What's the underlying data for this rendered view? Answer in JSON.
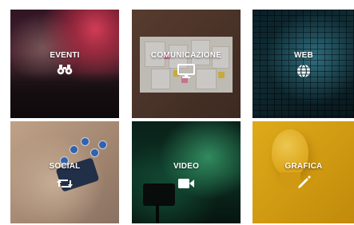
{
  "tiles": [
    {
      "label": "EVENTI",
      "icon": "binoculars-icon"
    },
    {
      "label": "COMUNICAZIONE",
      "icon": "monitor-icon"
    },
    {
      "label": "WEB",
      "icon": "globe-icon"
    },
    {
      "label": "SOCIAL",
      "icon": "retweet-icon"
    },
    {
      "label": "VIDEO",
      "icon": "video-camera-icon"
    },
    {
      "label": "GRAFICA",
      "icon": "pencil-icon"
    }
  ]
}
